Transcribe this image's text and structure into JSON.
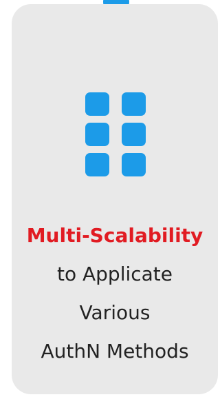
{
  "card": {
    "headline": "Multi-Scalability",
    "lines": [
      "to Applicate",
      "Various",
      "AuthN Methods"
    ]
  },
  "icons": {
    "top_indicator": "dot-icon",
    "feature_icon": "grid-icon"
  },
  "colors": {
    "accent_blue": "#1c9be8",
    "headline_red": "#e11b22",
    "card_background": "#e9e9e9",
    "body_text": "#222222"
  }
}
